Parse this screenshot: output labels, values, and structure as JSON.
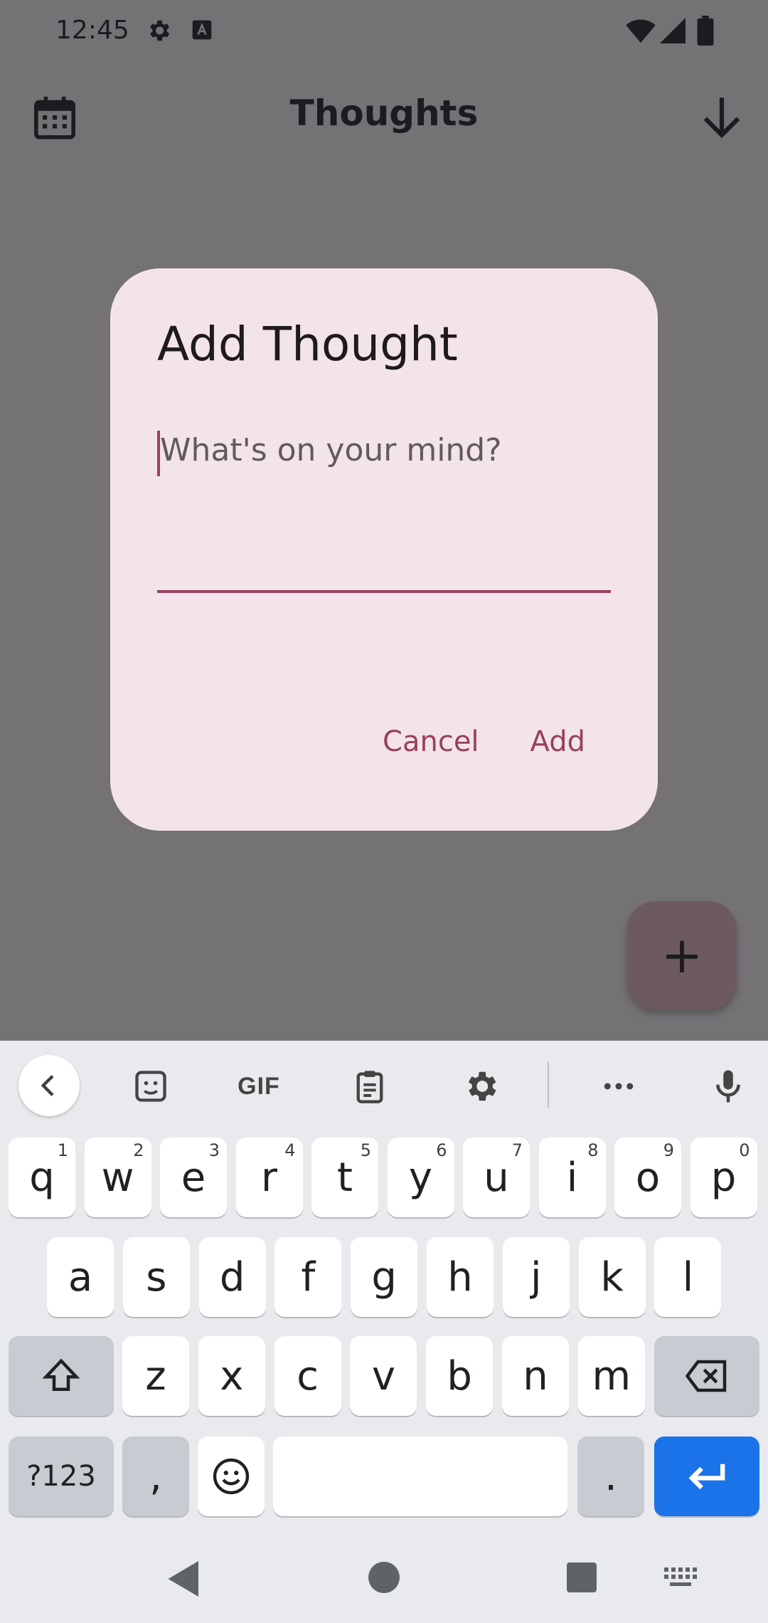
{
  "status_bar": {
    "time": "12:45",
    "icons": [
      "gear-icon",
      "font-a-icon",
      "wifi-icon",
      "signal-icon",
      "battery-icon"
    ]
  },
  "app_bar": {
    "title": "Thoughts",
    "left_icon": "calendar-icon",
    "right_icon": "arrow-down-icon"
  },
  "fab": {
    "icon": "plus-icon",
    "label": "+"
  },
  "dialog": {
    "title": "Add Thought",
    "input_placeholder": "What's on your mind?",
    "input_value": "",
    "cancel_label": "Cancel",
    "add_label": "Add"
  },
  "keyboard": {
    "toolbar": [
      "back-icon",
      "sticker-icon",
      "GIF",
      "clipboard-icon",
      "settings-icon",
      "more-icon",
      "mic-icon"
    ],
    "gif_label": "GIF",
    "row1": [
      {
        "k": "q",
        "h": "1"
      },
      {
        "k": "w",
        "h": "2"
      },
      {
        "k": "e",
        "h": "3"
      },
      {
        "k": "r",
        "h": "4"
      },
      {
        "k": "t",
        "h": "5"
      },
      {
        "k": "y",
        "h": "6"
      },
      {
        "k": "u",
        "h": "7"
      },
      {
        "k": "i",
        "h": "8"
      },
      {
        "k": "o",
        "h": "9"
      },
      {
        "k": "p",
        "h": "0"
      }
    ],
    "row2": [
      "a",
      "s",
      "d",
      "f",
      "g",
      "h",
      "j",
      "k",
      "l"
    ],
    "row3": [
      "z",
      "x",
      "c",
      "v",
      "b",
      "n",
      "m"
    ],
    "symbols_label": "?123",
    "comma": ",",
    "period": "."
  },
  "colors": {
    "accent": "#984061",
    "dialog_bg": "#f3e4ea",
    "scrim": "#747275",
    "enter_key": "#1a73e8"
  }
}
